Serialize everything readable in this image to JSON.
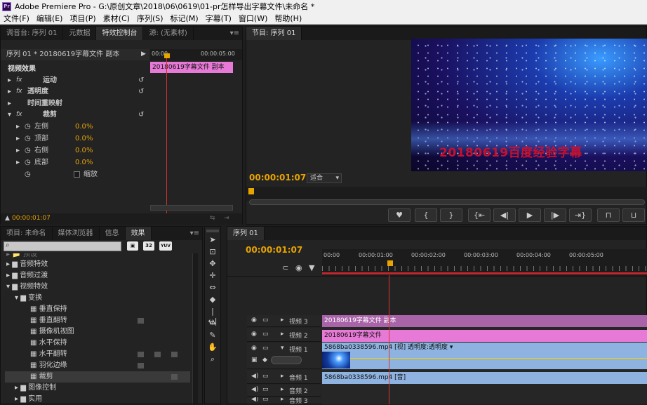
{
  "window": {
    "app_icon": "Pr",
    "title": "Adobe Premiere Pro - G:\\原创文章\\2018\\06\\0619\\01-pr怎样导出字幕文件\\未命名 *"
  },
  "menu": [
    "文件(F)",
    "编辑(E)",
    "项目(P)",
    "素材(C)",
    "序列(S)",
    "标记(M)",
    "字幕(T)",
    "窗口(W)",
    "帮助(H)"
  ],
  "effect_controls": {
    "tabs": [
      "调音台: 序列 01",
      "元数据",
      "特效控制台",
      "源: (无素材)"
    ],
    "sequence_label": "序列 01 * 20180619字幕文件 副本",
    "time_start": "00:00",
    "time_end": "00:00:05:00",
    "clip_label": "20180619字幕文件 副本",
    "section": "视频效果",
    "effects": [
      "运动",
      "透明度",
      "时间重映射",
      "裁剪"
    ],
    "params": [
      {
        "name": "左侧",
        "value": "0.0",
        "unit": "%"
      },
      {
        "name": "顶部",
        "value": "0.0",
        "unit": "%"
      },
      {
        "name": "右侧",
        "value": "0.0",
        "unit": "%"
      },
      {
        "name": "底部",
        "value": "0.0",
        "unit": "%"
      }
    ],
    "zoom_label": "缩放",
    "timecode": "00:00:01:07"
  },
  "program_monitor": {
    "tab": "节目: 序列 01",
    "overlay_text": "20180619百度经验字幕",
    "timecode": "00:00:01:07",
    "fit": "适合"
  },
  "project_panel": {
    "tabs": [
      "项目: 未命名",
      "媒体浏览器",
      "信息",
      "效果"
    ],
    "badges": [
      "32",
      "YUV"
    ],
    "tree": [
      {
        "label": "预设",
        "depth": 0,
        "type": "folder"
      },
      {
        "label": "音频特效",
        "depth": 0,
        "type": "folder"
      },
      {
        "label": "音频过渡",
        "depth": 0,
        "type": "folder"
      },
      {
        "label": "视频特效",
        "depth": 0,
        "type": "folder",
        "open": true
      },
      {
        "label": "变换",
        "depth": 1,
        "type": "folder",
        "open": true
      },
      {
        "label": "垂直保持",
        "depth": 2,
        "type": "effect"
      },
      {
        "label": "垂直翻转",
        "depth": 2,
        "type": "effect"
      },
      {
        "label": "摄像机视图",
        "depth": 2,
        "type": "effect"
      },
      {
        "label": "水平保持",
        "depth": 2,
        "type": "effect"
      },
      {
        "label": "水平翻转",
        "depth": 2,
        "type": "effect"
      },
      {
        "label": "羽化边缘",
        "depth": 2,
        "type": "effect"
      },
      {
        "label": "裁剪",
        "depth": 2,
        "type": "effect",
        "selected": true
      },
      {
        "label": "图像控制",
        "depth": 1,
        "type": "folder"
      },
      {
        "label": "实用",
        "depth": 1,
        "type": "folder"
      }
    ]
  },
  "timeline": {
    "tab": "序列 01",
    "timecode": "00:00:01:07",
    "ruler": [
      "00:00",
      "00:00:01:00",
      "00:00:02:00",
      "00:00:03:00",
      "00:00:04:00",
      "00:00:05:00"
    ],
    "tracks": [
      {
        "name": "视频 3",
        "clip": "20180619字幕文件 副本"
      },
      {
        "name": "视频 2",
        "clip": "20180619字幕文件"
      },
      {
        "name": "视频 1",
        "clip": "5868ba0338596.mp4 [视]  透明度:透明度 ▾"
      },
      {
        "name": "音频 1",
        "clip": "5868ba0338596.mp4 [音]"
      },
      {
        "name": "音频 2",
        "clip": ""
      },
      {
        "name": "音频 3",
        "clip": ""
      }
    ]
  },
  "colors": {
    "accent": "#e8a400",
    "title_clip": "#e67ad6",
    "video_clip": "#8fb3e0",
    "playhead": "#e03030"
  }
}
